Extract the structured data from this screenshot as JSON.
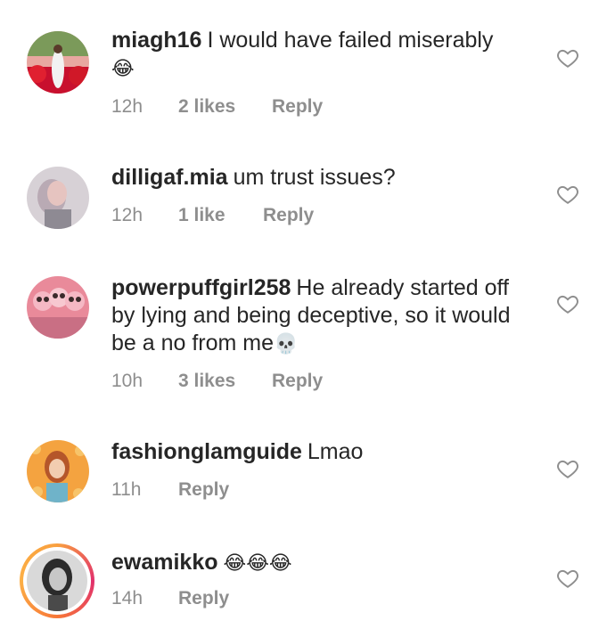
{
  "comments": [
    {
      "username": "miagh16",
      "text": "I would have failed miserably",
      "emoji": "😂",
      "time": "12h",
      "likes": "2 likes",
      "reply": "Reply"
    },
    {
      "username": "dilligaf.mia",
      "text": "um trust issues?",
      "emoji": "",
      "time": "12h",
      "likes": "1 like",
      "reply": "Reply"
    },
    {
      "username": "powerpuffgirl258",
      "text": "He already started off by lying and being deceptive, so it would be a no from me",
      "emoji": "💀",
      "time": "10h",
      "likes": "3 likes",
      "reply": "Reply"
    },
    {
      "username": "fashionglamguide",
      "text": "Lmao",
      "emoji": "",
      "time": "11h",
      "likes": "",
      "reply": "Reply"
    },
    {
      "username": "ewamikko",
      "text": "",
      "emoji": "😂😂😂",
      "time": "14h",
      "likes": "",
      "reply": "Reply"
    }
  ],
  "icons": {
    "avatar": "avatar",
    "like": "heart-outline-icon"
  },
  "colors": {
    "text": "#262626",
    "meta": "#8e8e8e",
    "story_ring": "#e1306c"
  }
}
